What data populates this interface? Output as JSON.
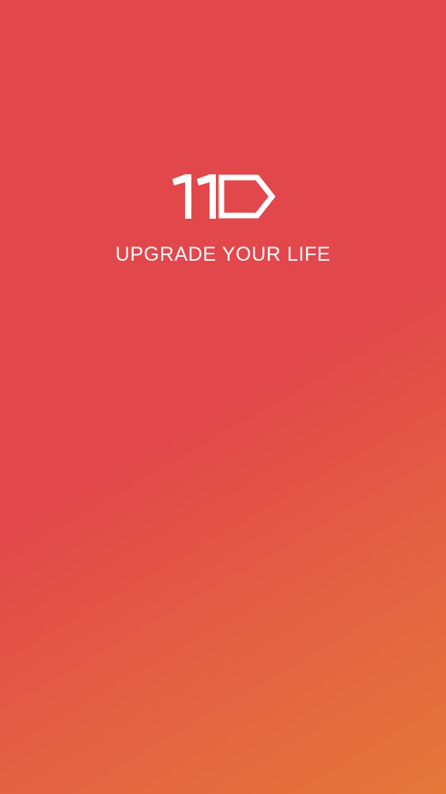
{
  "screen": {
    "name": "splash",
    "gradient_colors": [
      "#e2474b",
      "#e35e44",
      "#e4773a"
    ],
    "text_color": "#ffffff"
  },
  "logo": {
    "text": "11D",
    "icon": "brand-logo-icon"
  },
  "tagline": "UPGRADE YOUR LIFE"
}
